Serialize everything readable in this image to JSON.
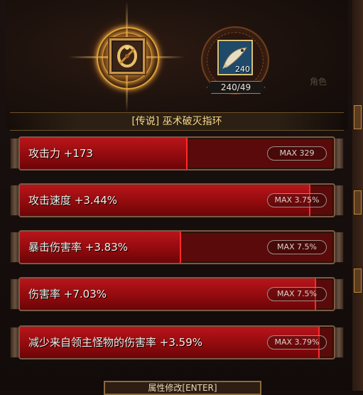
{
  "item": {
    "name_title": "[传说] 巫术破灭指环",
    "icon": "ring-item-icon"
  },
  "material": {
    "icon": "fish-material-icon",
    "count_badge": "240",
    "counter": "240/49"
  },
  "watermark": "角色",
  "stats": [
    {
      "label": "攻击力 +173",
      "max": "MAX 329",
      "fill": 0.53
    },
    {
      "label": "攻击速度 +3.44%",
      "max": "MAX 3.75%",
      "fill": 0.92
    },
    {
      "label": "暴击伤害率 +3.83%",
      "max": "MAX 7.5%",
      "fill": 0.51
    },
    {
      "label": "伤害率 +7.03%",
      "max": "MAX 7.5%",
      "fill": 0.94
    },
    {
      "label": "减少来自领主怪物的伤害率 +3.59%",
      "max": "MAX 3.79%",
      "fill": 0.95
    }
  ],
  "bottom_button": "属性修改[ENTER]",
  "colors": {
    "bar_fill": "#b8151a",
    "bar_bg": "#5a0a0a",
    "title_text": "#f6d68a",
    "glow": "#ffb84a"
  }
}
